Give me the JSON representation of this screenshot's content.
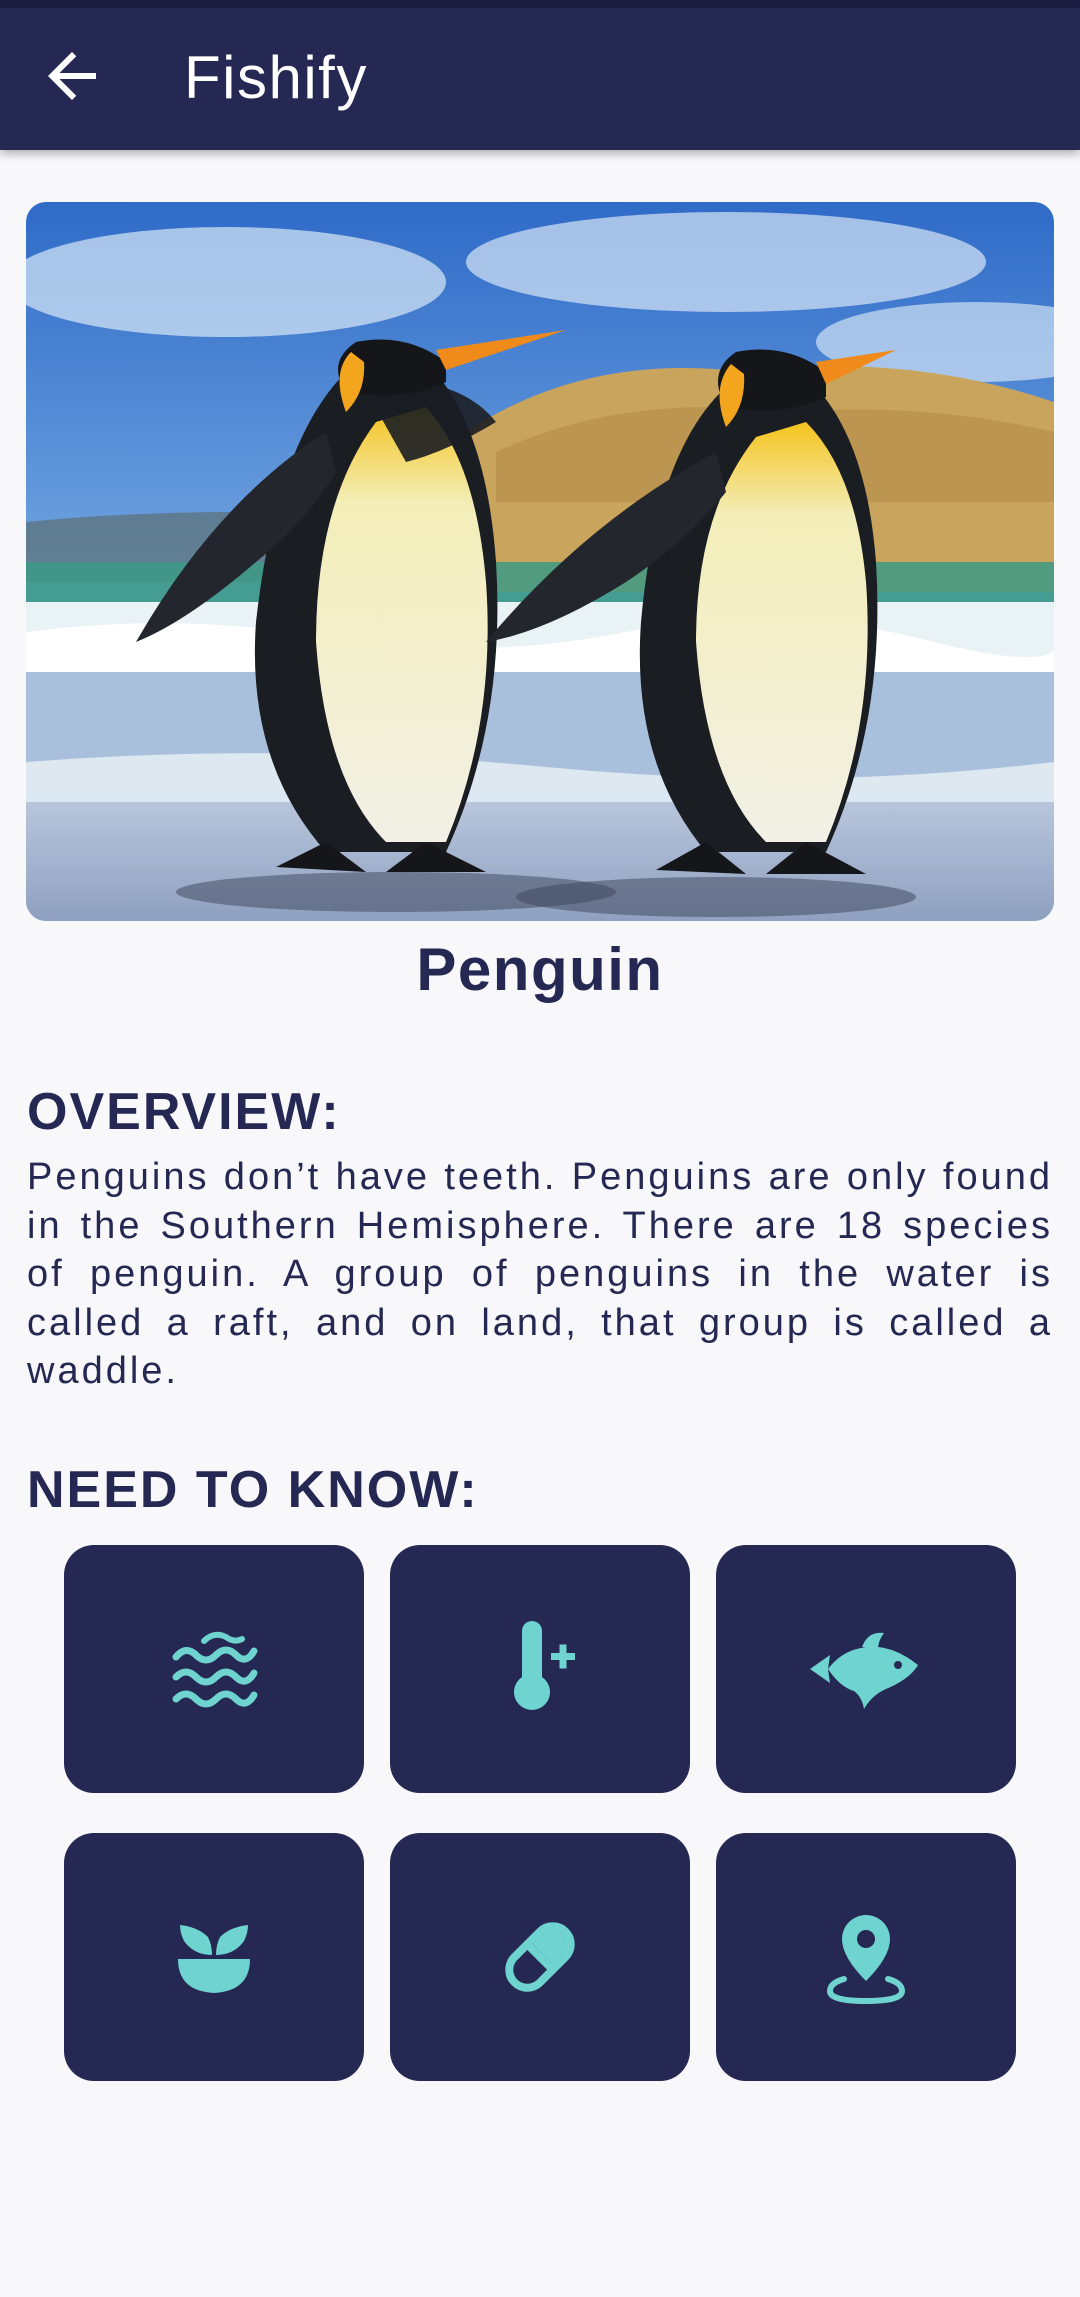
{
  "app_bar": {
    "title": "Fishify",
    "back_icon": "arrow-back-icon"
  },
  "species": {
    "name": "Penguin",
    "image": "two-king-penguins-walking-on-beach"
  },
  "overview": {
    "heading": "OVERVIEW:",
    "text": "Penguins don’t have teeth. Penguins are only found in the Southern Hemisphere. There are 18 species of penguin. A group of penguins in the water is called a raft, and on land, that group is called a waddle."
  },
  "need_to_know": {
    "heading": "NEED TO KNOW:",
    "tiles": [
      {
        "icon": "water-waves-icon"
      },
      {
        "icon": "thermometer-plus-icon"
      },
      {
        "icon": "fish-icon"
      },
      {
        "icon": "plant-pot-icon"
      },
      {
        "icon": "pill-icon"
      },
      {
        "icon": "location-pin-icon"
      }
    ]
  },
  "colors": {
    "primary": "#252853",
    "accent": "#6fd3cf",
    "background": "#f8f8fa",
    "on_primary": "#ffffff"
  }
}
